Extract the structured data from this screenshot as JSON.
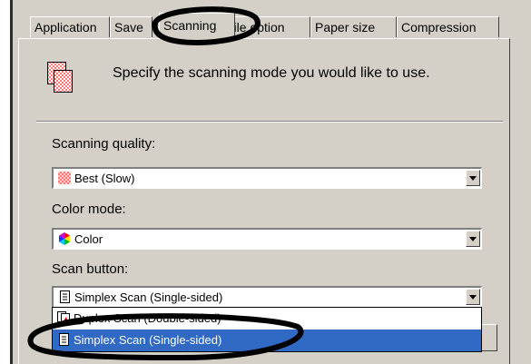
{
  "tabs": [
    {
      "label": "Application"
    },
    {
      "label": "Save"
    },
    {
      "label": "Scanning"
    },
    {
      "label": "File option"
    },
    {
      "label": "Paper size"
    },
    {
      "label": "Compression"
    }
  ],
  "panel": {
    "description": "Specify the scanning mode you would like to use.",
    "quality": {
      "label": "Scanning quality:",
      "value": "Best (Slow)"
    },
    "color": {
      "label": "Color mode:",
      "value": "Color"
    },
    "scan_button": {
      "label": "Scan button:",
      "value": "Simplex Scan (Single-sided)",
      "options": [
        "Duplex Scan (Double-sided)",
        "Simplex Scan (Single-sided)"
      ],
      "selected_index": 1
    }
  },
  "colors": {
    "selection": "#316ac5",
    "face": "#d4d0c8",
    "annotation": "#000000"
  }
}
